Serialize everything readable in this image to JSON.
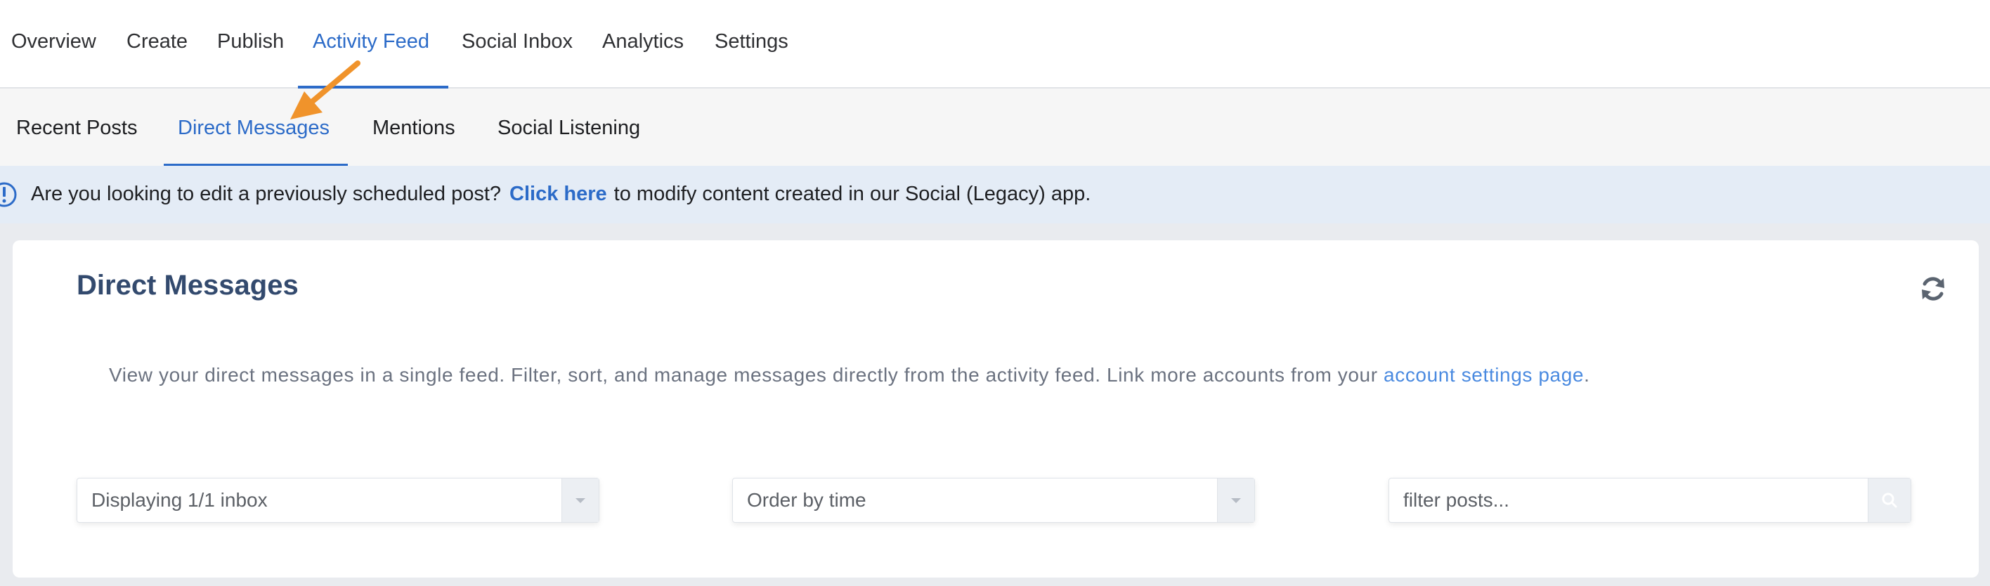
{
  "top_nav": {
    "tabs": [
      {
        "label": "Overview"
      },
      {
        "label": "Create"
      },
      {
        "label": "Publish"
      },
      {
        "label": "Activity Feed",
        "active": true
      },
      {
        "label": "Social Inbox"
      },
      {
        "label": "Analytics"
      },
      {
        "label": "Settings"
      }
    ]
  },
  "sub_nav": {
    "tabs": [
      {
        "label": "Recent Posts"
      },
      {
        "label": "Direct Messages",
        "active": true
      },
      {
        "label": "Mentions"
      },
      {
        "label": "Social Listening"
      }
    ]
  },
  "banner": {
    "icon": "info-icon",
    "text_before": "Are you looking to edit a previously scheduled post?",
    "link": "Click here",
    "text_after": "to modify content created in our Social (Legacy) app."
  },
  "card": {
    "title": "Direct Messages",
    "refresh_icon": "refresh-icon",
    "description": "View your direct messages in a single feed. Filter, sort, and manage messages directly from the activity feed. Link more accounts from your ",
    "description_link": "account settings page",
    "description_end": ".",
    "inbox_select": "Displaying 1/1 inbox",
    "order_select": "Order by time",
    "filter_placeholder": "filter posts..."
  },
  "colors": {
    "accent": "#2c6bc8",
    "title": "#334a6e",
    "arrow": "#f0932b",
    "banner_bg": "#e4ecf6"
  }
}
